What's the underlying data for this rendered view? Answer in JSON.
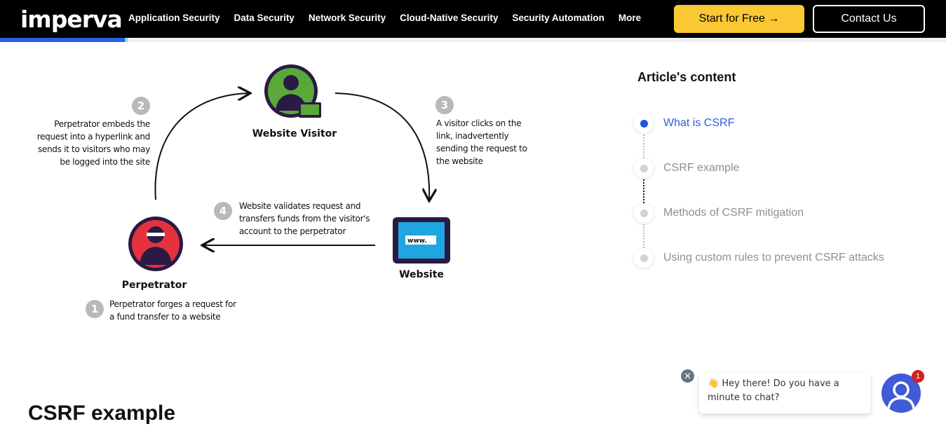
{
  "nav": {
    "logo": "imperva",
    "items": [
      "Application Security",
      "Data Security",
      "Network Security",
      "Cloud-Native Security",
      "Security Automation",
      "More"
    ],
    "start_free": "Start for Free →",
    "contact": "Contact Us"
  },
  "reading_progress_percent": 13.5,
  "diagram": {
    "labels": {
      "visitor": "Website Visitor",
      "perpetrator": "Perpetrator",
      "website": "Website",
      "www": "www."
    },
    "steps": [
      {
        "num": "1",
        "lines": [
          "Perpetrator forges a request for",
          "a fund transfer to a website"
        ]
      },
      {
        "num": "2",
        "lines": [
          "Perpetrator embeds the",
          "request into a hyperlink  and",
          "sends it to visitors who may",
          "be logged into the site"
        ]
      },
      {
        "num": "3",
        "lines": [
          "A visitor clicks on the",
          "link, inadvertently",
          "sending the request to",
          "the website"
        ]
      },
      {
        "num": "4",
        "lines": [
          "Website validates request and",
          "transfers funds from the visitor's",
          "account to the  perpetrator"
        ]
      }
    ]
  },
  "toc": {
    "title": "Article's content",
    "items": [
      {
        "label": "What is CSRF",
        "active": true
      },
      {
        "label": "CSRF example",
        "active": false
      },
      {
        "label": "Methods of CSRF mitigation",
        "active": false
      },
      {
        "label": "Using custom rules to prevent CSRF attacks",
        "active": false
      }
    ]
  },
  "section_heading": "CSRF example",
  "chat": {
    "emoji": "👋",
    "message": "Hey there! Do you have a minute to chat?",
    "badge": "1"
  },
  "colors": {
    "accent": "#2e5fe0",
    "cta": "#f9c834",
    "visitor": "#5aa83a",
    "perpetrator": "#e5323d",
    "website": "#1fa6e0"
  }
}
